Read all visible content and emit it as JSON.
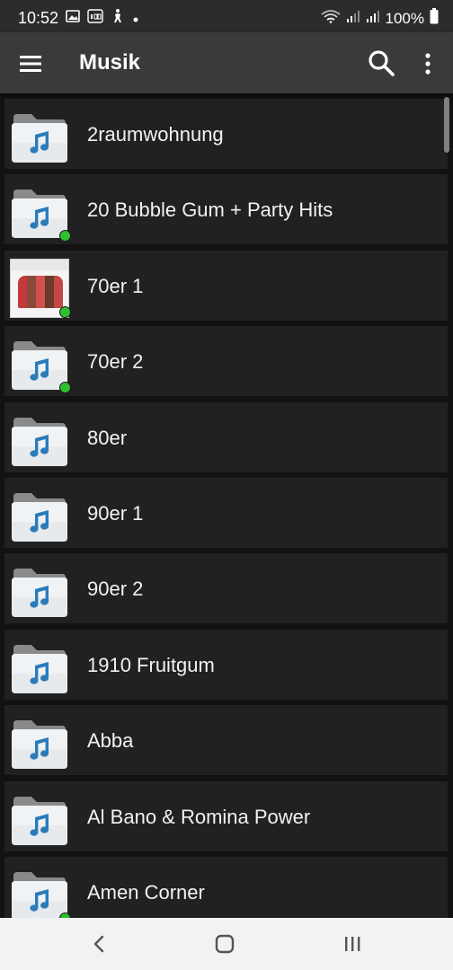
{
  "status_bar": {
    "time": "10:52",
    "left_icons": [
      "gallery-icon",
      "badge-100-icon",
      "accessibility-icon",
      "notification-dot-icon"
    ],
    "battery": "100%"
  },
  "app_bar": {
    "title": "Musik",
    "icons": [
      "hamburger-menu-icon",
      "search-icon",
      "more-vert-icon"
    ]
  },
  "folders": [
    {
      "label": "2raumwohnung",
      "thumb": "folder-music-icon",
      "offline_dot": false
    },
    {
      "label": "20 Bubble Gum + Party Hits",
      "thumb": "folder-music-icon",
      "offline_dot": true
    },
    {
      "label": "70er 1",
      "thumb": "album-cover",
      "offline_dot": true
    },
    {
      "label": "70er 2",
      "thumb": "folder-music-icon",
      "offline_dot": true
    },
    {
      "label": "80er",
      "thumb": "folder-music-icon",
      "offline_dot": false
    },
    {
      "label": "90er 1",
      "thumb": "folder-music-icon",
      "offline_dot": false
    },
    {
      "label": "90er 2",
      "thumb": "folder-music-icon",
      "offline_dot": false
    },
    {
      "label": "1910 Fruitgum",
      "thumb": "folder-music-icon",
      "offline_dot": false
    },
    {
      "label": "Abba",
      "thumb": "folder-music-icon",
      "offline_dot": false
    },
    {
      "label": "Al Bano & Romina Power",
      "thumb": "folder-music-icon",
      "offline_dot": false
    },
    {
      "label": "Amen Corner",
      "thumb": "folder-music-icon",
      "offline_dot": true
    }
  ],
  "nav_bar": {
    "icons": [
      "back-icon",
      "home-icon",
      "recents-icon"
    ]
  },
  "colors": {
    "background": "#121212",
    "row": "#212121",
    "app_bar": "#3a3a3a",
    "folder_note": "#2b7bb9",
    "status_dot": "#2ec02e"
  }
}
